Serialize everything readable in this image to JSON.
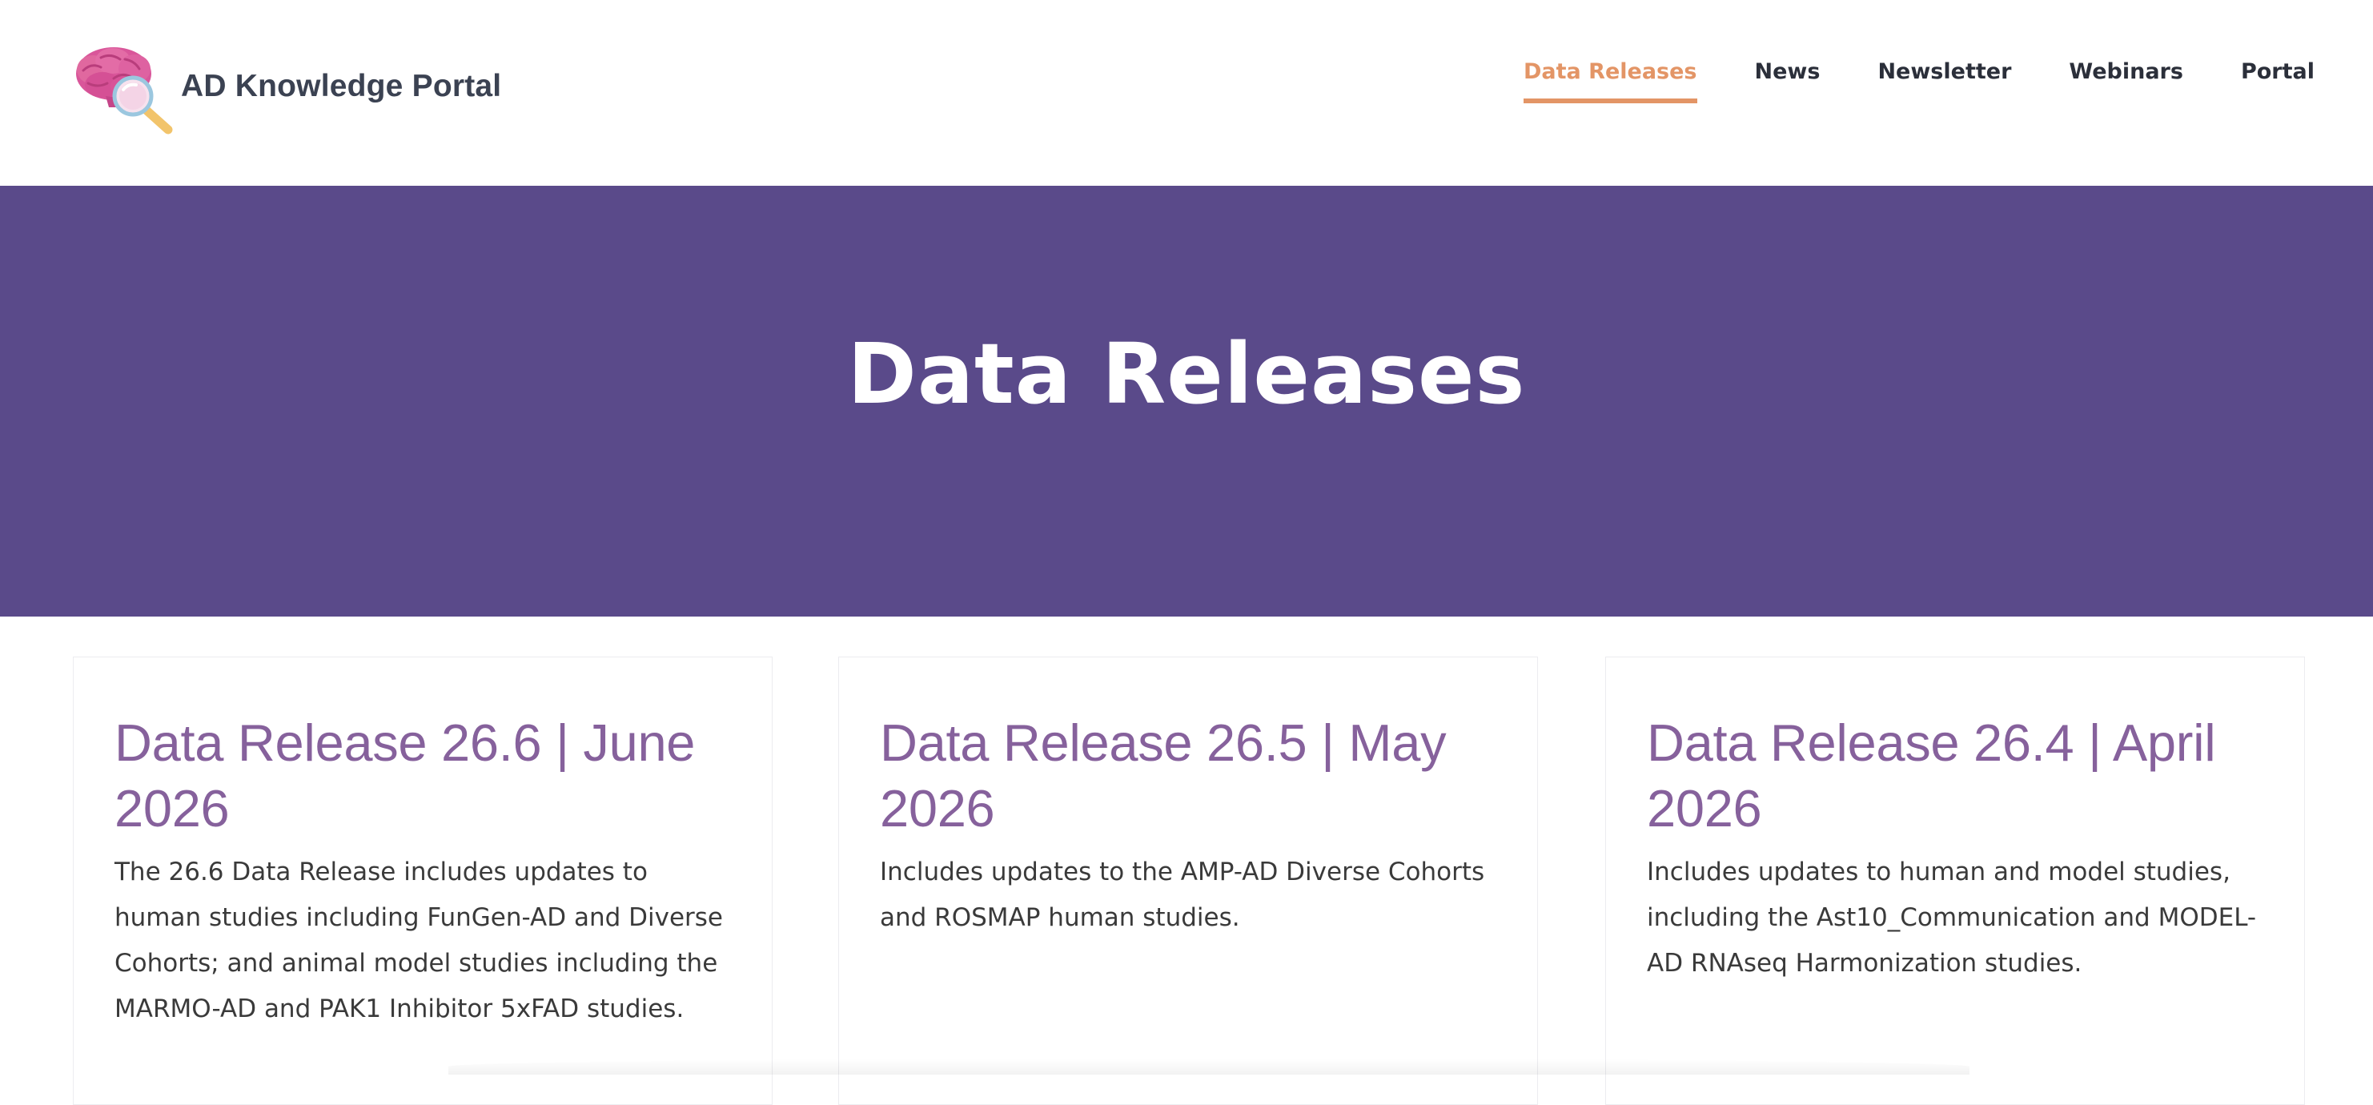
{
  "header": {
    "site_name": "AD Knowledge Portal",
    "logo_icon": "brain-magnifier-logo",
    "nav": [
      {
        "label": "Data Releases",
        "active": true
      },
      {
        "label": "News",
        "active": false
      },
      {
        "label": "Newsletter",
        "active": false
      },
      {
        "label": "Webinars",
        "active": false
      },
      {
        "label": "Portal",
        "active": false
      }
    ]
  },
  "hero": {
    "title": "Data Releases"
  },
  "cards": [
    {
      "title": "Data Release 26.6 | June 2026",
      "description": "The 26.6 Data Release includes updates to human studies including FunGen-AD and Diverse Cohorts; and animal model studies including the MARMO-AD and PAK1 Inhibitor 5xFAD studies."
    },
    {
      "title": "Data Release 26.5 | May 2026",
      "description": "Includes updates to the AMP-AD Diverse Cohorts and ROSMAP human studies."
    },
    {
      "title": "Data Release 26.4 | April 2026",
      "description": "Includes updates to human and model studies, including the Ast10_Communication and MODEL-AD RNAseq Harmonization studies."
    }
  ],
  "colors": {
    "hero_background": "#5a4a8a",
    "nav_active": "#e39566",
    "card_title": "#86619c"
  }
}
